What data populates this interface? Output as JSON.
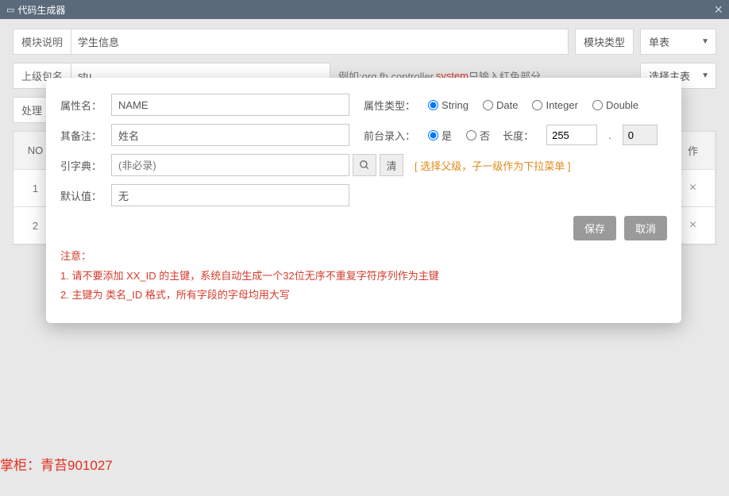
{
  "titlebar": {
    "icon": "▭",
    "title": "代码生成器"
  },
  "header": {
    "module_desc_label": "模块说明",
    "module_desc_value": "学生信息",
    "module_type_label": "模块类型",
    "module_type_value": "单表",
    "parent_pkg_label": "上级包名",
    "parent_pkg_value": "stu",
    "pkg_hint_prefix": "例如:org.fh.controller.",
    "pkg_hint_red": "system",
    "pkg_hint_suffix": " 只输入红色部分",
    "select_master": "选择主表",
    "handler_label": "处理"
  },
  "table": {
    "no_header": "NO",
    "action_header": "作",
    "rows": [
      {
        "no": "1"
      },
      {
        "no": "2"
      }
    ]
  },
  "modal": {
    "attr_name_label": "属性名",
    "attr_name_value": "NAME",
    "attr_type_label": "属性类型",
    "type_options": [
      "String",
      "Date",
      "Integer",
      "Double"
    ],
    "type_selected": "String",
    "remark_label": "其备注",
    "remark_value": "姓名",
    "frontend_input_label": "前台录入",
    "yes": "是",
    "no": "否",
    "frontend_selected": "是",
    "length_label": "长度",
    "length_value": "255",
    "length_decimal": "0",
    "dict_label": "引字典",
    "dict_placeholder": "(非必录)",
    "dict_clear": "清",
    "dict_hint": "[ 选择父级，子一级作为下拉菜单 ]",
    "default_label": "默认值",
    "default_value": "无",
    "save": "保存",
    "cancel": "取消",
    "notice_title": "注意：",
    "notice_1": "1. 请不要添加 XX_ID 的主键，系统自动生成一个32位无序不重复字符序列作为主键",
    "notice_2": "2. 主键为 类名_ID 格式，所有字段的字母均用大写"
  },
  "footer": "掌柜：青苔901027"
}
